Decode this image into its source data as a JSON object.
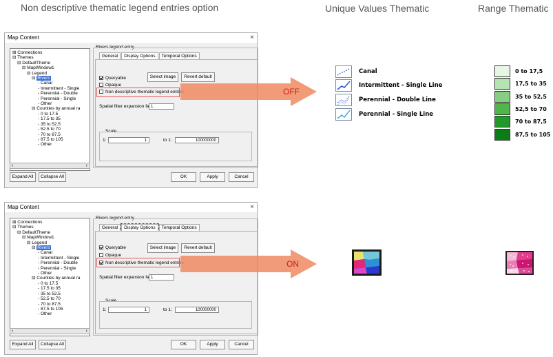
{
  "headers": {
    "left_title": "Non descriptive thematic legend entries option",
    "unique_values": "Unique Values Thematic",
    "range": "Range Thematic"
  },
  "dialog": {
    "title": "Map Content",
    "close_glyph": "×",
    "tree": [
      "Connections",
      "Themes",
      "DefaultTheme",
      "MapWindow1",
      "Legend",
      "Rivers",
      "Canal",
      "Intermittent - Single",
      "Perennial - Double",
      "Perennial - Single",
      "Other",
      "Counties by annual ra",
      "0 to 17.5",
      "17.5 to 35",
      "35 to 52.5",
      "52.5 to 70",
      "70 to 87.5",
      "87.5 to 105",
      "Other"
    ],
    "scroll_left": "‹",
    "scroll_right": "›",
    "group_label": "Rivers legend entry",
    "tabs": [
      "General",
      "Display Options",
      "Temporal Options"
    ],
    "queryable_label": "Queryable",
    "opaque_label": "Opaque",
    "nondescriptive_label": "Non descriptive thematic legend entries",
    "select_image": "Select image",
    "revert_default": "Revert default",
    "spatial_filter_label": "Spatial filter expansion factor:",
    "spatial_filter_value": "1",
    "scale_label": "Scale",
    "scale_from_label": "1:",
    "scale_from_value": "1",
    "scale_to_label": "to 1:",
    "scale_to_value": "100000000",
    "expand_all": "Expand All",
    "collapse_all": "Collapse All",
    "ok": "OK",
    "apply": "Apply",
    "cancel": "Cancel"
  },
  "arrows": {
    "off": "OFF",
    "on": "ON"
  },
  "unique_legend": [
    {
      "label": "Canal",
      "icon": "canal-line-icon"
    },
    {
      "label": "Intermittent - Single Line",
      "icon": "intermittent-line-icon"
    },
    {
      "label": "Perennial - Double Line",
      "icon": "perennial-double-line-icon"
    },
    {
      "label": "Perennial - Single Line",
      "icon": "perennial-single-line-icon"
    }
  ],
  "range_legend": [
    {
      "label": "0 to 17,5",
      "color": "#e6f7e6"
    },
    {
      "label": "17,5 to 35",
      "color": "#b5e3b2"
    },
    {
      "label": "35 to 52,5",
      "color": "#86cf82"
    },
    {
      "label": "52,5 to 70",
      "color": "#4fb64b"
    },
    {
      "label": "70 to 87,5",
      "color": "#21992a"
    },
    {
      "label": "87,5 to 105",
      "color": "#0a7d16"
    }
  ],
  "colors": {
    "arrow": "#f08a60",
    "highlight": "#e05555",
    "tree_selected": "#3a6fd8"
  }
}
